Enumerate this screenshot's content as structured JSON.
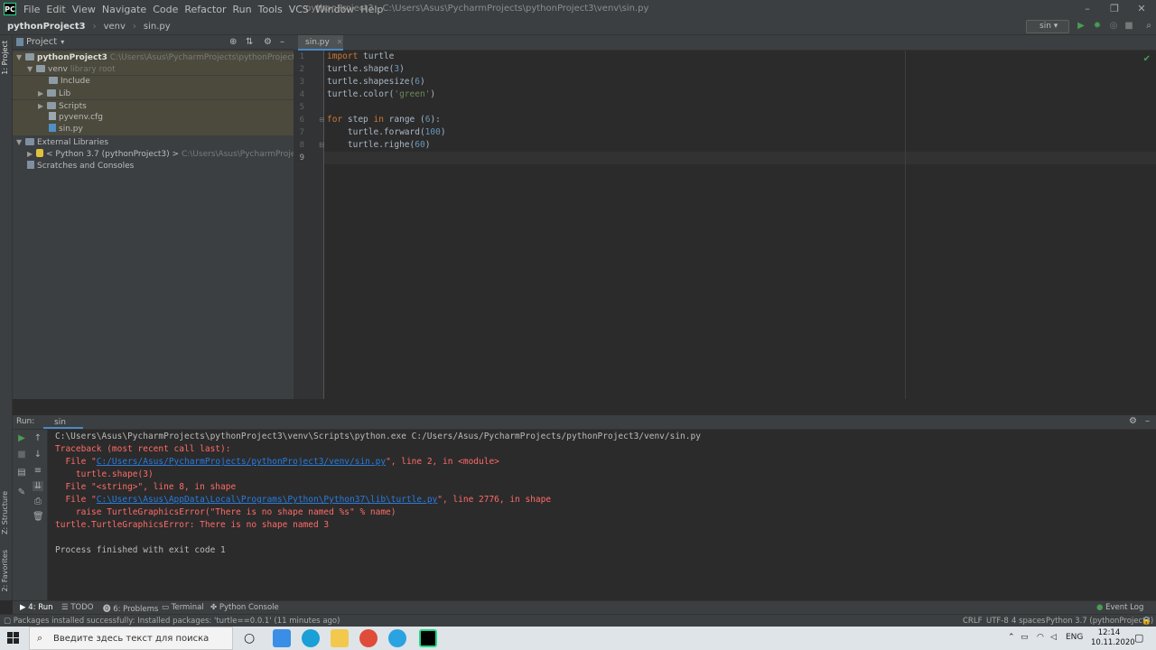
{
  "window": {
    "title": "pythonProject3 - C:\\Users\\Asus\\PycharmProjects\\pythonProject3\\venv\\sin.py",
    "logo_text": "PC",
    "menu": [
      "File",
      "Edit",
      "View",
      "Navigate",
      "Code",
      "Refactor",
      "Run",
      "Tools",
      "VCS",
      "Window",
      "Help"
    ]
  },
  "breadcrumb": [
    "pythonProject3",
    "venv",
    "sin.py"
  ],
  "run_config": "sin",
  "project_panel": {
    "title": "Project",
    "side_tab": "1: Project",
    "tree": [
      {
        "label": "pythonProject3",
        "extra": "C:\\Users\\Asus\\PycharmProjects\\pythonProject3"
      },
      {
        "label": "venv",
        "extra": "library root"
      },
      {
        "label": "Include"
      },
      {
        "label": "Lib"
      },
      {
        "label": "Scripts"
      },
      {
        "label": "pyvenv.cfg"
      },
      {
        "label": "sin.py"
      },
      {
        "label": "External Libraries"
      },
      {
        "label": "< Python 3.7 (pythonProject3) >",
        "extra": "C:\\Users\\Asus\\PycharmProjects\\pythonPro"
      },
      {
        "label": "Scratches and Consoles"
      }
    ]
  },
  "editor": {
    "tab": "sin.py",
    "line_numbers": [
      "1",
      "2",
      "3",
      "4",
      "5",
      "6",
      "7",
      "8",
      "9"
    ],
    "code": [
      "import turtle",
      "turtle.shape(3)",
      "turtle.shapesize(6)",
      "turtle.color('green')",
      "",
      "for step in range (6):",
      "    turtle.forward(100)",
      "    turtle.righe(60)",
      ""
    ]
  },
  "run_panel": {
    "label": "Run:",
    "tab": "sin",
    "console": {
      "cmd": "C:\\Users\\Asus\\PycharmProjects\\pythonProject3\\venv\\Scripts\\python.exe C:/Users/Asus/PycharmProjects/pythonProject3/venv/sin.py",
      "traceback": "Traceback (most recent call last):",
      "file1_pre": "  File \"",
      "file1_link": "C:/Users/Asus/PycharmProjects/pythonProject3/venv/sin.py",
      "file1_post": "\", line 2, in <module>",
      "file1_code": "    turtle.shape(3)",
      "file2": "  File \"<string>\", line 8, in shape",
      "file3_pre": "  File \"",
      "file3_link": "C:\\Users\\Asus\\AppData\\Local\\Programs\\Python\\Python37\\lib\\turtle.py",
      "file3_post": "\", line 2776, in shape",
      "file3_code": "    raise TurtleGraphicsError(\"There is no shape named %s\" % name)",
      "error": "turtle.TurtleGraphicsError: There is no shape named 3",
      "finished": "Process finished with exit code 1"
    }
  },
  "side_tabs": {
    "structure": "Z: Structure",
    "favorites": "2: Favorites"
  },
  "bottom_tabs": [
    "4: Run",
    "TODO",
    "6: Problems",
    "Terminal",
    "Python Console"
  ],
  "event_log": "Event Log",
  "status": {
    "message": "Packages installed successfully: Installed packages: 'turtle==0.0.1' (11 minutes ago)",
    "line_sep": "CRLF",
    "encoding": "UTF-8",
    "indent": "4 spaces",
    "interpreter": "Python 3.7 (pythonProject3)"
  },
  "taskbar": {
    "search_placeholder": "Введите здесь текст для поиска",
    "lang": "ENG",
    "time": "12:14",
    "date": "10.11.2020"
  }
}
